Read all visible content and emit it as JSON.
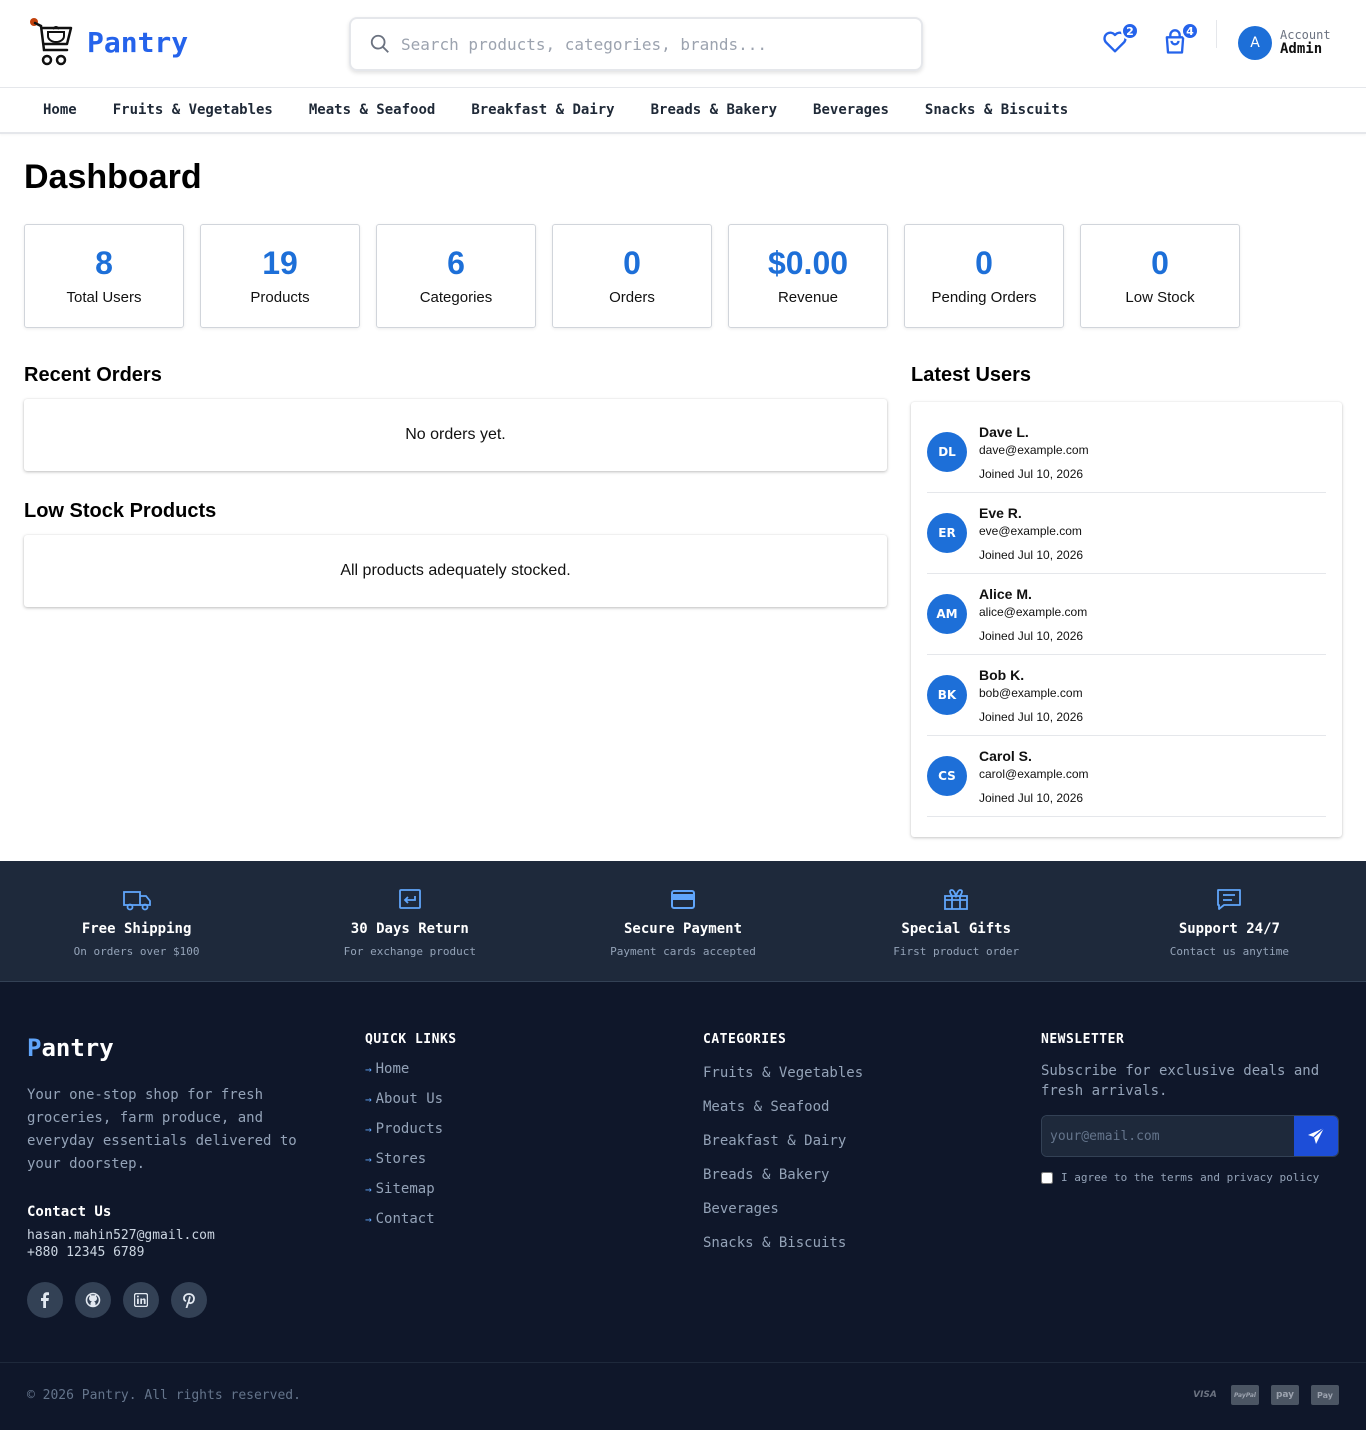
{
  "brand": {
    "name": "Pantry"
  },
  "search": {
    "placeholder": "Search products, categories, brands..."
  },
  "header": {
    "wishlist_count": "2",
    "cart_count": "4",
    "account_small": "Account",
    "account_name": "Admin",
    "avatar_letter": "A"
  },
  "nav": [
    "Home",
    "Fruits & Vegetables",
    "Meats & Seafood",
    "Breakfast & Dairy",
    "Breads & Bakery",
    "Beverages",
    "Snacks & Biscuits"
  ],
  "dashboard": {
    "title": "Dashboard",
    "stats": [
      {
        "value": "8",
        "label": "Total Users"
      },
      {
        "value": "19",
        "label": "Products"
      },
      {
        "value": "6",
        "label": "Categories"
      },
      {
        "value": "0",
        "label": "Orders"
      },
      {
        "value": "$0.00",
        "label": "Revenue"
      },
      {
        "value": "0",
        "label": "Pending Orders"
      },
      {
        "value": "0",
        "label": "Low Stock"
      }
    ],
    "recent_orders_title": "Recent Orders",
    "recent_orders_empty": "No orders yet.",
    "low_stock_title": "Low Stock Products",
    "low_stock_empty": "All products adequately stocked.",
    "latest_users_title": "Latest Users",
    "users": [
      {
        "initials": "DL",
        "name": "Dave L.",
        "email": "dave@example.com",
        "joined": "Joined Jul 10, 2026"
      },
      {
        "initials": "ER",
        "name": "Eve R.",
        "email": "eve@example.com",
        "joined": "Joined Jul 10, 2026"
      },
      {
        "initials": "AM",
        "name": "Alice M.",
        "email": "alice@example.com",
        "joined": "Joined Jul 10, 2026"
      },
      {
        "initials": "BK",
        "name": "Bob K.",
        "email": "bob@example.com",
        "joined": "Joined Jul 10, 2026"
      },
      {
        "initials": "CS",
        "name": "Carol S.",
        "email": "carol@example.com",
        "joined": "Joined Jul 10, 2026"
      }
    ]
  },
  "features": [
    {
      "icon": "truck-icon",
      "title": "Free Shipping",
      "sub": "On orders over $100"
    },
    {
      "icon": "return-icon",
      "title": "30 Days Return",
      "sub": "For exchange product"
    },
    {
      "icon": "credit-card-icon",
      "title": "Secure Payment",
      "sub": "Payment cards accepted"
    },
    {
      "icon": "gift-icon",
      "title": "Special Gifts",
      "sub": "First product order"
    },
    {
      "icon": "chat-icon",
      "title": "Support 24/7",
      "sub": "Contact us anytime"
    }
  ],
  "footer": {
    "brand_first": "P",
    "brand_rest": "antry",
    "description": "Your one-stop shop for fresh groceries, farm produce, and everyday essentials delivered to your doorstep.",
    "contact_title": "Contact Us",
    "email": "hasan.mahin527@gmail.com",
    "phone": "+880 12345 6789",
    "quick_links_title": "QUICK LINKS",
    "quick_links": [
      "Home",
      "About Us",
      "Products",
      "Stores",
      "Sitemap",
      "Contact"
    ],
    "categories_title": "CATEGORIES",
    "categories": [
      "Fruits & Vegetables",
      "Meats & Seafood",
      "Breakfast & Dairy",
      "Breads & Bakery",
      "Beverages",
      "Snacks & Biscuits"
    ],
    "newsletter_title": "NEWSLETTER",
    "newsletter_desc": "Subscribe for exclusive deals and fresh arrivals.",
    "newsletter_placeholder": "your@email.com",
    "agree_text": "I agree to the terms and privacy policy",
    "copyright": "© 2026 Pantry. All rights reserved.",
    "payments": [
      "VISA",
      "PayPal",
      "pay",
      "Pay"
    ]
  },
  "colors": {
    "accent": "#2563eb",
    "stat_value": "#1d6fd8",
    "footer_bg": "#0f172a",
    "features_bg": "#1e293b"
  }
}
